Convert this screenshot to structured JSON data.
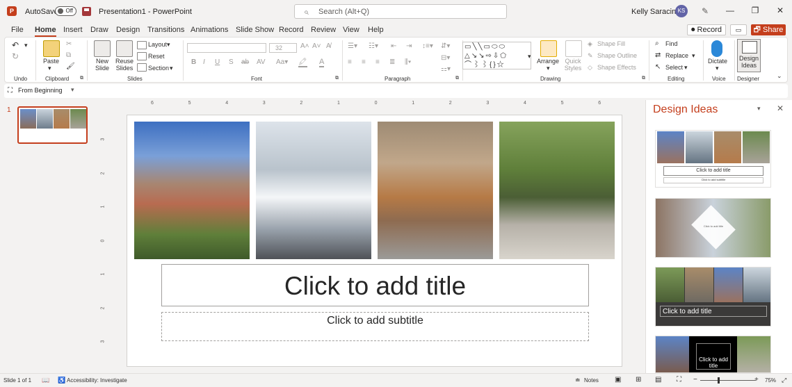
{
  "titlebar": {
    "autosave_label": "AutoSave",
    "autosave_state": "Off",
    "doc_title": "Presentation1  -  PowerPoint",
    "search_placeholder": "Search (Alt+Q)",
    "user_name": "Kelly Saracino",
    "user_initials": "KS"
  },
  "tabs": [
    "File",
    "Home",
    "Insert",
    "Draw",
    "Design",
    "Transitions",
    "Animations",
    "Slide Show",
    "Record",
    "Review",
    "View",
    "Help"
  ],
  "active_tab": "Home",
  "actions": {
    "record": "⏺ Record",
    "share": "🗗 Share"
  },
  "ribbon": {
    "groups": {
      "undo": "Undo",
      "clipboard": "Clipboard",
      "slides": "Slides",
      "font": "Font",
      "paragraph": "Paragraph",
      "drawing": "Drawing",
      "editing": "Editing",
      "voice": "Voice",
      "designer": "Designer"
    },
    "paste": "Paste",
    "new_slide": "New\nSlide",
    "reuse_slides": "Reuse\nSlides",
    "layout": "Layout",
    "reset": "Reset",
    "section": "Section",
    "font_size": "32",
    "arrange": "Arrange",
    "quick_styles": "Quick\nStyles",
    "shape_fill": "Shape Fill",
    "shape_outline": "Shape Outline",
    "shape_effects": "Shape Effects",
    "find": "Find",
    "replace": "Replace",
    "select": "Select",
    "dictate": "Dictate",
    "design_ideas": "Design\nIdeas"
  },
  "qat": {
    "from_beginning": "From Beginning"
  },
  "thumbnails": {
    "slide_number": "1"
  },
  "ruler": {
    "horizontal": [
      "6",
      "5",
      "4",
      "3",
      "2",
      "1",
      "0",
      "1",
      "2",
      "3",
      "4",
      "5",
      "6"
    ],
    "vertical": [
      "3",
      "2",
      "1",
      "0",
      "1",
      "2",
      "3"
    ]
  },
  "slide": {
    "title_placeholder": "Click to add title",
    "subtitle_placeholder": "Click to add subtitle"
  },
  "design_pane": {
    "title": "Design Ideas",
    "idea_title": "Click to add title",
    "idea_subtitle": "Click to add subtitle"
  },
  "statusbar": {
    "slide_info": "Slide 1 of 1",
    "accessibility": "Accessibility: Investigate",
    "notes": "Notes",
    "zoom": "75%"
  },
  "colors": {
    "accent": "#c43e1c",
    "designer_accent": "#e4ac00"
  }
}
